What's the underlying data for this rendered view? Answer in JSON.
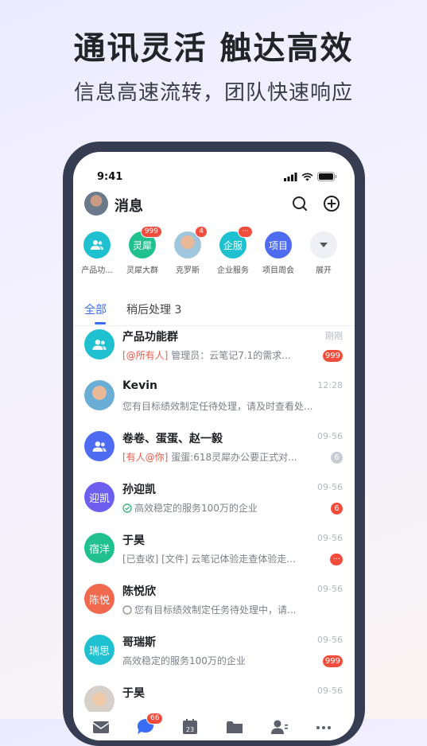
{
  "promo": {
    "headline": "通讯灵活 触达高效",
    "subline": "信息高速流转，团队快速响应"
  },
  "status_bar": {
    "time": "9:41"
  },
  "header": {
    "title": "消息"
  },
  "quick_access": [
    {
      "label": "产品功...",
      "icon": "group-icon",
      "color": "#1fc0cf",
      "badge": ""
    },
    {
      "label": "灵犀大群",
      "icon_text": "灵犀",
      "color": "#20c08f",
      "badge": "999"
    },
    {
      "label": "克罗斯",
      "icon": "person-photo",
      "color": "#6aaed6",
      "badge": "4"
    },
    {
      "label": "企业服务",
      "icon_text": "企服",
      "color": "#1fc0cf",
      "badge": "···"
    },
    {
      "label": "项目周会",
      "icon_text": "项目",
      "color": "#4e6cf2",
      "badge": ""
    },
    {
      "label": "展开",
      "icon": "chevron-down-icon",
      "color": "#eef0f5",
      "badge": ""
    }
  ],
  "tabs": [
    {
      "label": "全部",
      "active": true
    },
    {
      "label": "稍后处理 3",
      "active": false
    }
  ],
  "conversations": [
    {
      "name": "产品功能群",
      "time": "刚刚",
      "mention": "[@所有人]",
      "preview": " 管理员：云笔记7.1的需求...",
      "badge": "999",
      "badge_type": "red",
      "avatar_color": "#1fc0cf",
      "avatar_icon": "group-icon"
    },
    {
      "name": "Kevin",
      "time": "12:28",
      "mention": "",
      "preview": "您有目标绩效制定任待处理，请及时查看处...",
      "badge": "",
      "badge_type": "",
      "avatar_color": "#6aaed6",
      "avatar_icon": "person-photo"
    },
    {
      "name": "卷卷、蛋蛋、赵一毅",
      "time": "09-56",
      "mention": "[有人@你]",
      "preview": " 蛋蛋:618灵犀办公要正式对...",
      "badge": "6",
      "badge_type": "grey",
      "avatar_color": "#4e6cf2",
      "avatar_icon": "group-icon"
    },
    {
      "name": "孙迎凯",
      "time": "09-56",
      "mention": "",
      "preview": "高效稳定的服务100万的企业",
      "badge": "6",
      "badge_type": "red",
      "avatar_color": "#6c5ff0",
      "avatar_text": "迎凯",
      "prefix_icon": "check-circle-icon"
    },
    {
      "name": "于昊",
      "time": "09-56",
      "mention": "",
      "preview": "[已查收] [文件] 云笔记体验走查体验走...",
      "badge": "···",
      "badge_type": "red",
      "avatar_color": "#20c08f",
      "avatar_text": "宿洋"
    },
    {
      "name": "陈悦欣",
      "time": "09-56",
      "mention": "",
      "preview": "您有目标绩效制定任务待处理中，请...",
      "badge": "",
      "badge_type": "",
      "avatar_color": "#f0694f",
      "avatar_text": "陈悦",
      "prefix_icon": "circle-icon"
    },
    {
      "name": "哥瑞斯",
      "time": "09-56",
      "mention": "",
      "preview": "高效稳定的服务100万的企业",
      "badge": "999",
      "badge_type": "red",
      "avatar_color": "#1fc0cf",
      "avatar_text": "瑞思"
    },
    {
      "name": "于昊",
      "time": "09-56",
      "mention": "",
      "preview": "",
      "badge": "",
      "badge_type": "",
      "avatar_color": "#d6d0c8",
      "avatar_icon": "person-photo"
    }
  ],
  "tab_bar": {
    "items": [
      {
        "icon": "mail-icon"
      },
      {
        "icon": "message-icon",
        "badge": "66"
      },
      {
        "icon": "calendar-icon",
        "icon_text": "23"
      },
      {
        "icon": "folder-icon"
      },
      {
        "icon": "contacts-icon"
      },
      {
        "icon": "more-icon"
      }
    ]
  }
}
